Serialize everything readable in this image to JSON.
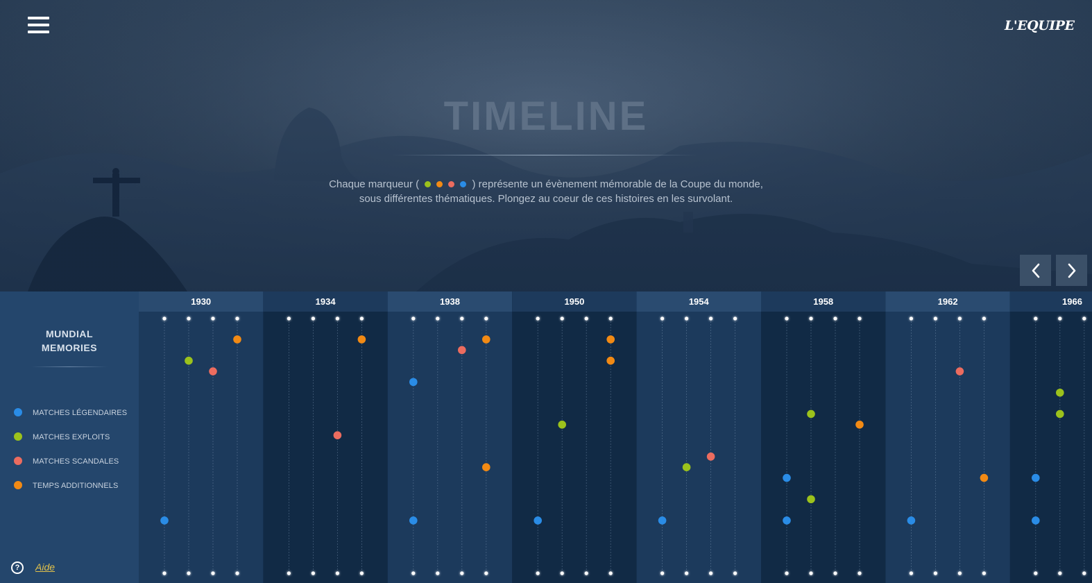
{
  "app": {
    "brand": "L'EQUIPE",
    "title": "TIMELINE",
    "intro_line1_before": "Chaque marqueur (",
    "intro_line1_after": ") représente un évènement mémorable de la Coupe du monde,",
    "intro_line2": "sous différentes thématiques. Plongez au coeur de ces histoires en les survolant."
  },
  "colors": {
    "legendary": "#2a8ce6",
    "exploits": "#9cc21c",
    "scandals": "#ec6c5f",
    "extra_time": "#f28a14",
    "help_link": "#e3c24b"
  },
  "intro_markers": [
    "exploits",
    "extra_time",
    "scandals",
    "legendary"
  ],
  "sidebar": {
    "title_line1": "MUNDIAL",
    "title_line2": "MEMORIES",
    "legend": [
      {
        "label": "MATCHES LÉGENDAIRES",
        "category": "legendary"
      },
      {
        "label": "MATCHES EXPLOITS",
        "category": "exploits"
      },
      {
        "label": "MATCHES SCANDALES",
        "category": "scandals"
      },
      {
        "label": "TEMPS ADDITIONNELS",
        "category": "extra_time"
      }
    ],
    "help_label": "Aide",
    "help_icon": "?"
  },
  "nav": {
    "prev_icon": "chevron-left-icon",
    "next_icon": "chevron-right-icon",
    "menu_icon": "hamburger-menu-icon"
  },
  "timeline": {
    "years": [
      "1930",
      "1934",
      "1938",
      "1950",
      "1954",
      "1958",
      "1962",
      "1966"
    ],
    "markers": [
      {
        "year": "1930",
        "lane": 3,
        "level": 0.0,
        "category": "extra_time"
      },
      {
        "year": "1930",
        "lane": 1,
        "level": 0.1,
        "category": "exploits"
      },
      {
        "year": "1930",
        "lane": 2,
        "level": 0.15,
        "category": "scandals"
      },
      {
        "year": "1930",
        "lane": 0,
        "level": 0.85,
        "category": "legendary"
      },
      {
        "year": "1934",
        "lane": 3,
        "level": 0.0,
        "category": "extra_time"
      },
      {
        "year": "1934",
        "lane": 2,
        "level": 0.45,
        "category": "scandals"
      },
      {
        "year": "1938",
        "lane": 3,
        "level": 0.0,
        "category": "extra_time"
      },
      {
        "year": "1938",
        "lane": 2,
        "level": 0.05,
        "category": "scandals"
      },
      {
        "year": "1938",
        "lane": 0,
        "level": 0.2,
        "category": "legendary"
      },
      {
        "year": "1938",
        "lane": 3,
        "level": 0.6,
        "category": "extra_time"
      },
      {
        "year": "1938",
        "lane": 0,
        "level": 0.85,
        "category": "legendary"
      },
      {
        "year": "1950",
        "lane": 3,
        "level": 0.0,
        "category": "extra_time"
      },
      {
        "year": "1950",
        "lane": 3,
        "level": 0.1,
        "category": "extra_time"
      },
      {
        "year": "1950",
        "lane": 1,
        "level": 0.4,
        "category": "exploits"
      },
      {
        "year": "1950",
        "lane": 0,
        "level": 0.85,
        "category": "legendary"
      },
      {
        "year": "1954",
        "lane": 2,
        "level": 0.55,
        "category": "scandals"
      },
      {
        "year": "1954",
        "lane": 1,
        "level": 0.6,
        "category": "exploits"
      },
      {
        "year": "1954",
        "lane": 0,
        "level": 0.85,
        "category": "legendary"
      },
      {
        "year": "1958",
        "lane": 1,
        "level": 0.35,
        "category": "exploits"
      },
      {
        "year": "1958",
        "lane": 3,
        "level": 0.4,
        "category": "extra_time"
      },
      {
        "year": "1958",
        "lane": 0,
        "level": 0.65,
        "category": "legendary"
      },
      {
        "year": "1958",
        "lane": 1,
        "level": 0.75,
        "category": "exploits"
      },
      {
        "year": "1958",
        "lane": 0,
        "level": 0.85,
        "category": "legendary"
      },
      {
        "year": "1962",
        "lane": 2,
        "level": 0.15,
        "category": "scandals"
      },
      {
        "year": "1962",
        "lane": 3,
        "level": 0.65,
        "category": "extra_time"
      },
      {
        "year": "1962",
        "lane": 0,
        "level": 0.85,
        "category": "legendary"
      },
      {
        "year": "1966",
        "lane": 1,
        "level": 0.25,
        "category": "exploits"
      },
      {
        "year": "1966",
        "lane": 1,
        "level": 0.35,
        "category": "exploits"
      },
      {
        "year": "1966",
        "lane": 0,
        "level": 0.65,
        "category": "legendary"
      },
      {
        "year": "1966",
        "lane": 0,
        "level": 0.85,
        "category": "legendary"
      }
    ]
  }
}
